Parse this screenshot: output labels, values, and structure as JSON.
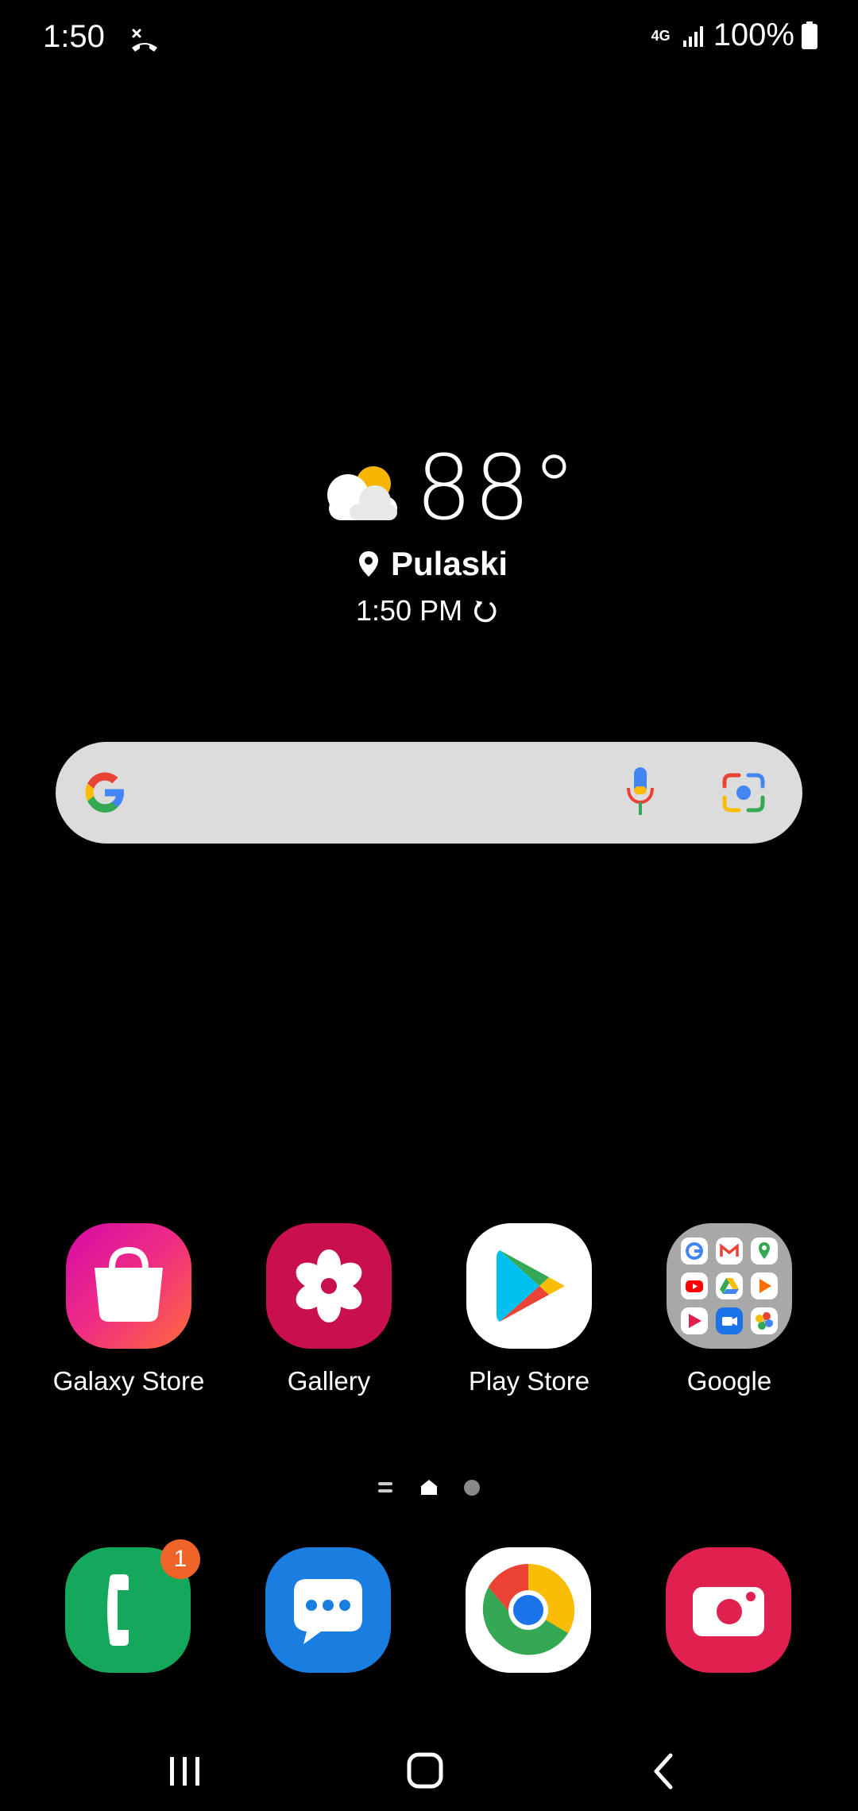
{
  "status_bar": {
    "time": "1:50",
    "network": "4G",
    "battery": "100%"
  },
  "weather": {
    "temperature": "88°",
    "location": "Pulaski",
    "updated_time": "1:50 PM",
    "condition_icon": "partly-cloudy-icon"
  },
  "search": {
    "icons": [
      "google-logo-icon",
      "microphone-icon",
      "google-lens-icon"
    ]
  },
  "apps": [
    {
      "label": "Galaxy Store",
      "icon": "shopping-bag-icon"
    },
    {
      "label": "Gallery",
      "icon": "flower-icon"
    },
    {
      "label": "Play Store",
      "icon": "play-store-icon"
    },
    {
      "label": "Google",
      "icon": "google-folder-icon"
    }
  ],
  "dock": [
    {
      "name": "Phone",
      "icon": "phone-icon",
      "badge": "1"
    },
    {
      "name": "Messages",
      "icon": "messages-icon"
    },
    {
      "name": "Chrome",
      "icon": "chrome-icon"
    },
    {
      "name": "Camera",
      "icon": "camera-icon"
    }
  ],
  "colors": {
    "background": "#000000",
    "search_bar": "#dcdcdc",
    "gallery": "#c8104f",
    "phone": "#14a85a",
    "messages": "#1a7ee0",
    "camera": "#e0204f",
    "badge": "#f0642a"
  },
  "pager": {
    "current_page": 1,
    "pages": 2
  },
  "nav": [
    "recent-apps-icon",
    "home-icon",
    "back-icon"
  ]
}
